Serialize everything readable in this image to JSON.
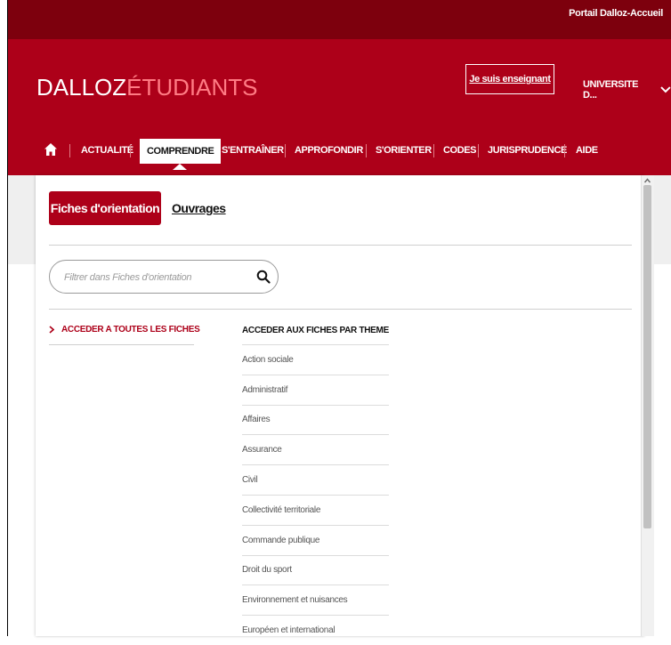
{
  "topbar": {
    "portal_link": "Portail Dalloz-Accueil"
  },
  "header": {
    "logo": {
      "part1": "DALLOZ",
      "part2": "ÉTUDIANTS"
    },
    "teacher_button": "Je suis enseignant",
    "university": "UNIVERSITE D..."
  },
  "nav": {
    "items": [
      "ACTUALITÉ",
      "COMPRENDRE",
      "S'ENTRAÎNER",
      "APPROFONDIR",
      "S'ORIENTER",
      "CODES",
      "JURISPRUDENCE",
      "AIDE"
    ],
    "active": "COMPRENDRE"
  },
  "panel": {
    "tabs": [
      "Fiches d'orientation",
      "Ouvrages"
    ],
    "search": {
      "placeholder": "Filtrer dans Fiches d'orientation",
      "value": ""
    },
    "all_link": "ACCEDER A TOUTES LES FICHES",
    "themes_title": "ACCEDER AUX FICHES PAR THEME",
    "themes": [
      "Action sociale",
      "Administratif",
      "Affaires",
      "Assurance",
      "Civil",
      "Collectivité territoriale",
      "Commande publique",
      "Droit du sport",
      "Environnement et nuisances",
      "Européen et international"
    ]
  },
  "colors": {
    "brand": "#ad0019",
    "topbar": "#7d000d",
    "logo_accent": "#ff7b84"
  },
  "icons": [
    "home-icon",
    "chevron-down-icon",
    "search-icon",
    "chevron-right-icon",
    "scroll-up-icon"
  ]
}
